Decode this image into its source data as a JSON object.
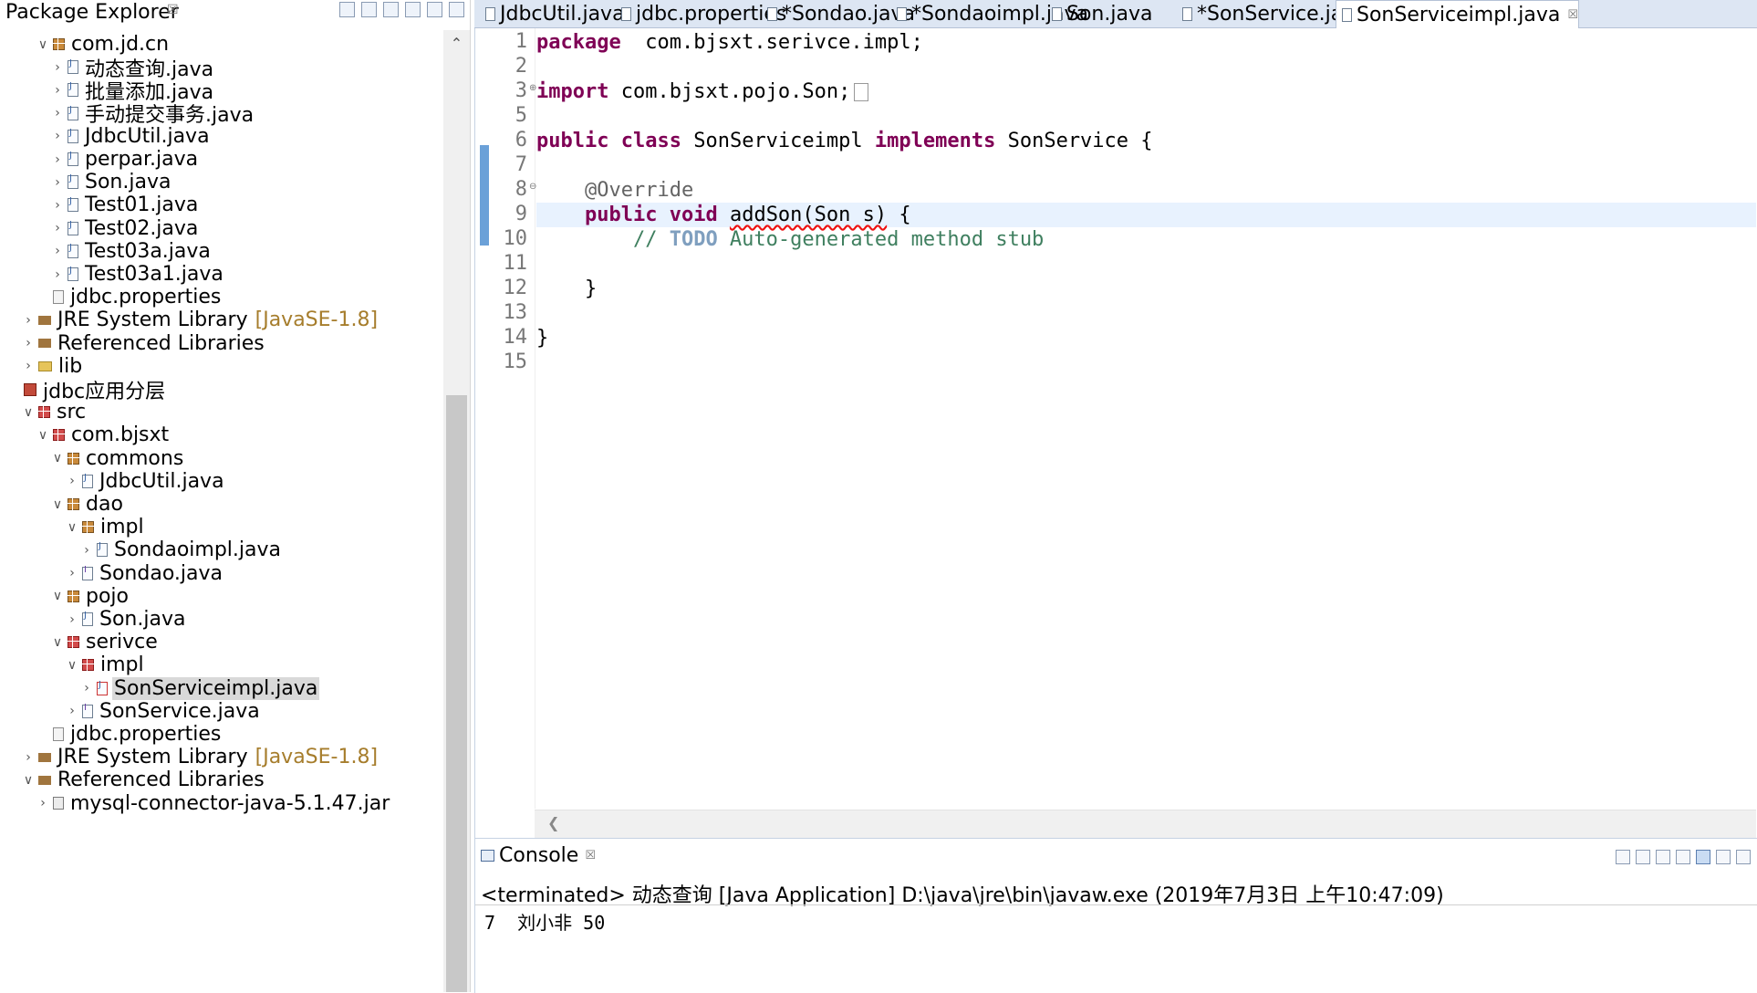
{
  "package_explorer": {
    "title": "Package Explorer",
    "close_glyph": "☒",
    "tree": [
      {
        "label": "com.jd.cn",
        "depth": 1,
        "toggle": "v",
        "icon": "package-icon"
      },
      {
        "label": "动态查询.java",
        "depth": 2,
        "toggle": ">",
        "icon": "java-file-icon"
      },
      {
        "label": "批量添加.java",
        "depth": 2,
        "toggle": ">",
        "icon": "java-file-icon"
      },
      {
        "label": "手动提交事务.java",
        "depth": 2,
        "toggle": ">",
        "icon": "java-file-icon"
      },
      {
        "label": "JdbcUtil.java",
        "depth": 2,
        "toggle": ">",
        "icon": "java-file-icon"
      },
      {
        "label": "perpar.java",
        "depth": 2,
        "toggle": ">",
        "icon": "java-file-icon"
      },
      {
        "label": "Son.java",
        "depth": 2,
        "toggle": ">",
        "icon": "java-file-icon"
      },
      {
        "label": "Test01.java",
        "depth": 2,
        "toggle": ">",
        "icon": "java-file-icon"
      },
      {
        "label": "Test02.java",
        "depth": 2,
        "toggle": ">",
        "icon": "java-file-icon"
      },
      {
        "label": "Test03a.java",
        "depth": 2,
        "toggle": ">",
        "icon": "java-file-icon"
      },
      {
        "label": "Test03a1.java",
        "depth": 2,
        "toggle": ">",
        "icon": "java-file-icon"
      },
      {
        "label": "jdbc.properties",
        "depth": 1,
        "toggle": "",
        "icon": "properties-file-icon"
      },
      {
        "label": "JRE System Library",
        "decoration": "[JavaSE-1.8]",
        "depth": 0,
        "toggle": ">",
        "icon": "library-icon"
      },
      {
        "label": "Referenced Libraries",
        "depth": 0,
        "toggle": ">",
        "icon": "library-icon"
      },
      {
        "label": "lib",
        "depth": 0,
        "toggle": ">",
        "icon": "folder-icon"
      },
      {
        "label": "jdbc应用分层",
        "depth": -1,
        "toggle": "",
        "icon": "project-icon"
      },
      {
        "label": "src",
        "depth": 0,
        "toggle": "v",
        "icon": "source-folder-icon"
      },
      {
        "label": "com.bjsxt",
        "depth": 1,
        "toggle": "v",
        "icon": "package-error-icon"
      },
      {
        "label": "commons",
        "depth": 2,
        "toggle": "v",
        "icon": "package-icon"
      },
      {
        "label": "JdbcUtil.java",
        "depth": 3,
        "toggle": ">",
        "icon": "java-file-icon"
      },
      {
        "label": "dao",
        "depth": 2,
        "toggle": "v",
        "icon": "package-icon"
      },
      {
        "label": "impl",
        "depth": 3,
        "toggle": "v",
        "icon": "package-icon"
      },
      {
        "label": "Sondaoimpl.java",
        "depth": 4,
        "toggle": ">",
        "icon": "java-file-icon"
      },
      {
        "label": "Sondao.java",
        "depth": 3,
        "toggle": ">",
        "icon": "java-interface-icon"
      },
      {
        "label": "pojo",
        "depth": 2,
        "toggle": "v",
        "icon": "package-icon"
      },
      {
        "label": "Son.java",
        "depth": 3,
        "toggle": ">",
        "icon": "java-file-icon"
      },
      {
        "label": "serivce",
        "depth": 2,
        "toggle": "v",
        "icon": "package-error-icon"
      },
      {
        "label": "impl",
        "depth": 3,
        "toggle": "v",
        "icon": "package-error-icon"
      },
      {
        "label": "SonServiceimpl.java",
        "depth": 4,
        "toggle": ">",
        "icon": "java-file-error-icon",
        "selected": true
      },
      {
        "label": "SonService.java",
        "depth": 3,
        "toggle": ">",
        "icon": "java-interface-icon"
      },
      {
        "label": "jdbc.properties",
        "depth": 1,
        "toggle": "",
        "icon": "properties-file-icon"
      },
      {
        "label": "JRE System Library",
        "decoration": "[JavaSE-1.8]",
        "depth": 0,
        "toggle": ">",
        "icon": "library-icon"
      },
      {
        "label": "Referenced Libraries",
        "depth": 0,
        "toggle": "v",
        "icon": "library-icon"
      },
      {
        "label": "mysql-connector-java-5.1.47.jar",
        "depth": 1,
        "toggle": ">",
        "icon": "jar-icon"
      }
    ]
  },
  "editor_tabs": [
    {
      "label": "JdbcUtil.java",
      "active": false
    },
    {
      "label": "jdbc.properties",
      "active": false
    },
    {
      "label": "*Sondao.java",
      "active": false
    },
    {
      "label": "*Sondaoimpl.java",
      "active": false
    },
    {
      "label": "Son.java",
      "active": false
    },
    {
      "label": "*SonService.java",
      "active": false
    },
    {
      "label": "SonServiceimpl.java",
      "active": true
    }
  ],
  "editor": {
    "lines": [
      {
        "n": "1",
        "tokens": [
          [
            "kw",
            "package"
          ],
          [
            "",
            "  com.bjsxt.serivce.impl;"
          ]
        ]
      },
      {
        "n": "2",
        "tokens": []
      },
      {
        "n": "3",
        "tokens": [
          [
            "kw",
            "import"
          ],
          [
            "",
            " com.bjsxt.pojo.Son;"
          ]
        ],
        "fold": "⊕",
        "collapsed": true
      },
      {
        "n": "5",
        "tokens": []
      },
      {
        "n": "6",
        "tokens": [
          [
            "kw",
            "public"
          ],
          [
            "",
            " "
          ],
          [
            "kw",
            "class"
          ],
          [
            "",
            " SonServiceimpl "
          ],
          [
            "kw",
            "implements"
          ],
          [
            "",
            " SonService {"
          ]
        ]
      },
      {
        "n": "7",
        "tokens": []
      },
      {
        "n": "8",
        "tokens": [
          [
            "",
            " "
          ],
          [
            "an",
            "   @Override"
          ]
        ],
        "fold": "⊖"
      },
      {
        "n": "9",
        "tokens": [
          [
            "",
            "    "
          ],
          [
            "kw",
            "public"
          ],
          [
            "",
            " "
          ],
          [
            "kw",
            "void"
          ],
          [
            "",
            " "
          ],
          [
            "sq",
            "addSon(Son s)"
          ],
          [
            "",
            " {"
          ]
        ],
        "current": true
      },
      {
        "n": "10",
        "tokens": [
          [
            "cm",
            "        // "
          ],
          [
            "todo",
            "TODO"
          ],
          [
            "cm",
            " Auto-generated method stub"
          ]
        ]
      },
      {
        "n": "11",
        "tokens": []
      },
      {
        "n": "12",
        "tokens": [
          [
            "",
            "    }"
          ]
        ]
      },
      {
        "n": "13",
        "tokens": []
      },
      {
        "n": "14",
        "tokens": [
          [
            "",
            "}"
          ]
        ]
      },
      {
        "n": "15",
        "tokens": []
      }
    ]
  },
  "console": {
    "title": "Console",
    "status": "<terminated> 动态查询 [Java Application] D:\\java\\jre\\bin\\javaw.exe (2019年7月3日 上午10:47:09)",
    "output": "7  刘小非 50"
  }
}
